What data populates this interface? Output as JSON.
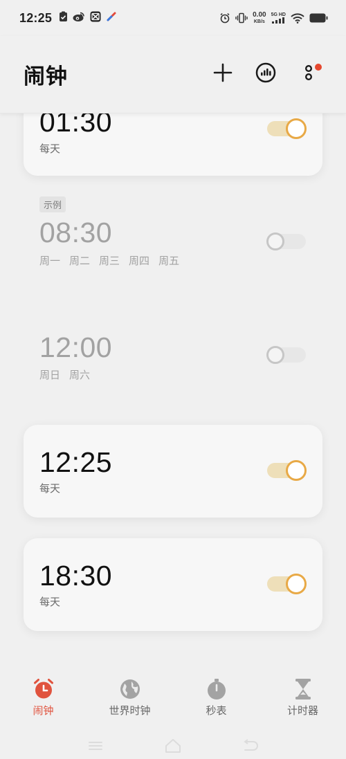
{
  "status_bar": {
    "time": "12:25",
    "net_speed_value": "0.00",
    "net_speed_unit": "KB/s",
    "signal_label": "5G HD",
    "left_icons": [
      "clipboard-icon",
      "weibo-icon",
      "capcut-icon",
      "app-icon"
    ],
    "right_icons": [
      "alarm-status-icon",
      "vibrate-icon",
      "signal-icon",
      "wifi-icon",
      "battery-icon"
    ]
  },
  "header": {
    "title": "闹钟",
    "actions": [
      "add-icon",
      "dial-icon",
      "more-icon"
    ]
  },
  "alarms": [
    {
      "tag": "",
      "time": "01:30",
      "repeat": [
        "每天"
      ],
      "enabled": true
    },
    {
      "tag": "示例",
      "time": "08:30",
      "repeat": [
        "周一",
        "周二",
        "周三",
        "周四",
        "周五"
      ],
      "enabled": false
    },
    {
      "tag": "",
      "time": "12:00",
      "repeat": [
        "周日",
        "周六"
      ],
      "enabled": false
    },
    {
      "tag": "",
      "time": "12:25",
      "repeat": [
        "每天"
      ],
      "enabled": true
    },
    {
      "tag": "",
      "time": "18:30",
      "repeat": [
        "每天"
      ],
      "enabled": true
    }
  ],
  "bottom_nav": [
    {
      "label": "闹钟",
      "icon": "alarm-clock-icon",
      "active": true
    },
    {
      "label": "世界时钟",
      "icon": "globe-icon",
      "active": false
    },
    {
      "label": "秒表",
      "icon": "stopwatch-icon",
      "active": false
    },
    {
      "label": "计时器",
      "icon": "hourglass-icon",
      "active": false
    }
  ],
  "colors": {
    "accent": "#e8a946",
    "active_tab": "#e0533e",
    "background": "#f0f0f0"
  }
}
